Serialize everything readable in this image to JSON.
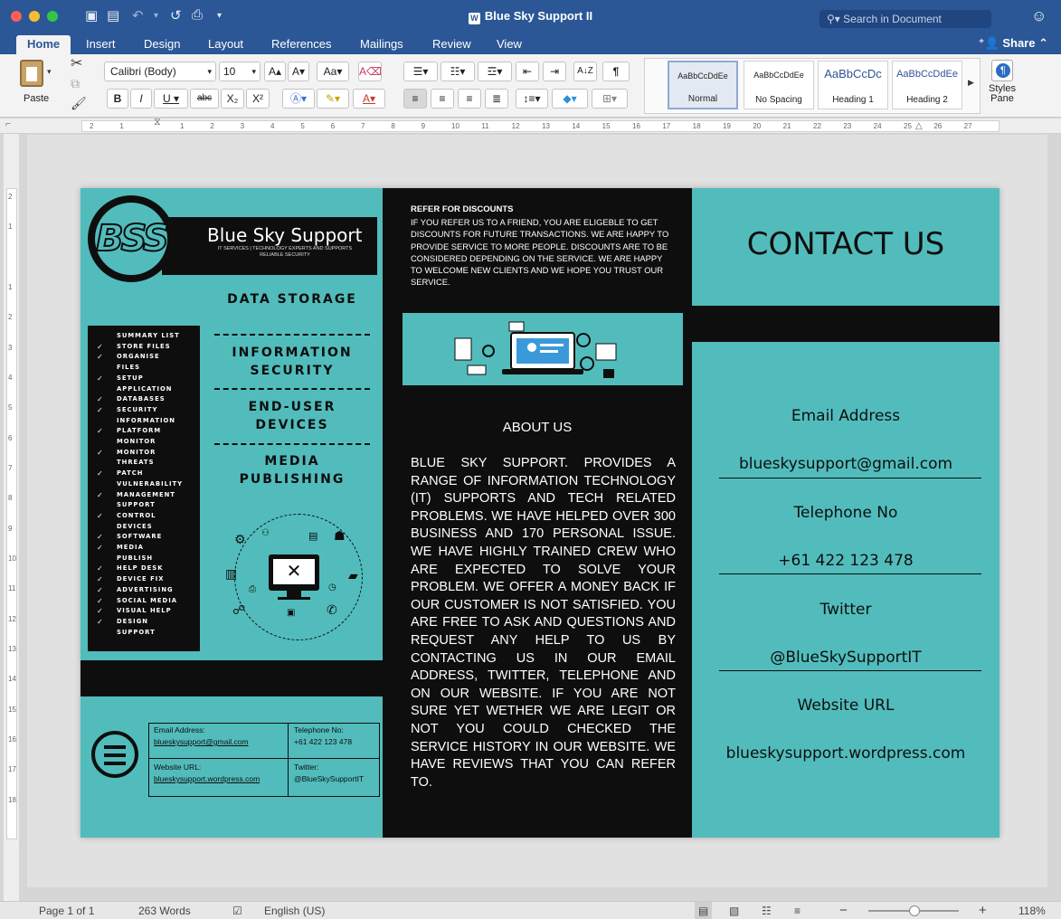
{
  "window": {
    "title": "Blue Sky Support II",
    "search_placeholder": "Search in Document"
  },
  "ribbon_tabs": [
    "Home",
    "Insert",
    "Design",
    "Layout",
    "References",
    "Mailings",
    "Review",
    "View"
  ],
  "share_label": "Share",
  "ribbon": {
    "paste_label": "Paste",
    "font_name": "Calibri (Body)",
    "font_size": "10",
    "styles": [
      {
        "sample": "AaBbCcDdEe",
        "name": "Normal"
      },
      {
        "sample": "AaBbCcDdEe",
        "name": "No Spacing"
      },
      {
        "sample": "AaBbCcDc",
        "name": "Heading 1"
      },
      {
        "sample": "AaBbCcDdEe",
        "name": "Heading 2"
      }
    ],
    "styles_pane_label": "Styles Pane"
  },
  "ruler_numbers": [
    "2",
    "1",
    "",
    "1",
    "2",
    "3",
    "4",
    "5",
    "6",
    "7",
    "8",
    "9",
    "10",
    "11",
    "12",
    "13",
    "14",
    "15",
    "16",
    "17",
    "18",
    "19",
    "20",
    "21",
    "22",
    "23",
    "24",
    "25",
    "26",
    "27"
  ],
  "vruler_numbers": [
    "2",
    "1",
    "",
    "1",
    "2",
    "3",
    "4",
    "5",
    "6",
    "7",
    "8",
    "9",
    "10",
    "11",
    "12",
    "13",
    "14",
    "15",
    "16",
    "17",
    "18"
  ],
  "doc": {
    "panel1": {
      "logo_text": "BSS",
      "brand_title": "Blue Sky Support",
      "brand_subtitle": "IT SERVICES | TECHNOLOGY EXPERTS AND SUPPORTS RELIABLE SECURITY",
      "services": [
        "DATA STORAGE",
        "INFORMATION SECURITY",
        "END-USER DEVICES",
        "MEDIA PUBLISHING"
      ],
      "checklist": [
        {
          "mark": "",
          "text": "Summary List"
        },
        {
          "mark": "✓",
          "text": "Store Files"
        },
        {
          "mark": "✓",
          "text": "Organise"
        },
        {
          "mark": "",
          "text": "Files"
        },
        {
          "mark": "✓",
          "text": "Setup"
        },
        {
          "mark": "",
          "text": "Application"
        },
        {
          "mark": "✓",
          "text": "Databases"
        },
        {
          "mark": "✓",
          "text": "Security"
        },
        {
          "mark": "",
          "text": "Information"
        },
        {
          "mark": "✓",
          "text": "Platform"
        },
        {
          "mark": "",
          "text": "Monitor"
        },
        {
          "mark": "✓",
          "text": "Monitor"
        },
        {
          "mark": "",
          "text": "Threats"
        },
        {
          "mark": "✓",
          "text": "Patch"
        },
        {
          "mark": "",
          "text": "Vulnerability"
        },
        {
          "mark": "✓",
          "text": "Management"
        },
        {
          "mark": "",
          "text": "Support"
        },
        {
          "mark": "✓",
          "text": "Control"
        },
        {
          "mark": "",
          "text": "Devices"
        },
        {
          "mark": "✓",
          "text": "Software"
        },
        {
          "mark": "✓",
          "text": "Media"
        },
        {
          "mark": "",
          "text": "Publish"
        },
        {
          "mark": "✓",
          "text": "Help Desk"
        },
        {
          "mark": "✓",
          "text": "Device Fix"
        },
        {
          "mark": "✓",
          "text": "Advertising"
        },
        {
          "mark": "✓",
          "text": "Social Media"
        },
        {
          "mark": "✓",
          "text": "Visual Help"
        },
        {
          "mark": "✓",
          "text": "Design"
        },
        {
          "mark": "",
          "text": "Support"
        }
      ],
      "contact_table": {
        "email_label": "Email Address:",
        "email_value": "blueskysupport@gmail.com",
        "phone_label": "Telephone No:",
        "phone_value": "+61 422 123 478",
        "website_label": "Website URL:",
        "website_value": "blueskysupport.wordpress.com",
        "twitter_label": "Twitter:",
        "twitter_value": "@BlueSkySupportIT"
      }
    },
    "panel2": {
      "refer_heading": "REFER FOR DISCOUNTS",
      "refer_body": "IF YOU REFER US TO A FRIEND, YOU ARE ELIGEBLE TO GET DISCOUNTS FOR FUTURE TRANSACTIONS. WE ARE HAPPY TO PROVIDE SERVICE TO MORE PEOPLE. DISCOUNTS ARE TO BE CONSIDERED DEPENDING ON THE SERVICE. WE ARE HAPPY TO WELCOME NEW CLIENTS AND WE HOPE YOU TRUST OUR SERVICE.",
      "about_heading": "ABOUT US",
      "about_body": "BLUE SKY SUPPORT. PROVIDES A RANGE OF INFORMATION TECHNOLOGY (IT) SUPPORTS AND TECH RELATED PROBLEMS. WE HAVE HELPED OVER 300 BUSINESS AND 170 PERSONAL ISSUE. WE HAVE HIGHLY TRAINED CREW WHO ARE EXPECTED TO SOLVE YOUR PROBLEM. WE OFFER A MONEY BACK IF OUR CUSTOMER IS NOT SATISFIED. YOU ARE FREE TO ASK AND QUESTIONS AND REQUEST ANY HELP TO US BY CONTACTING US IN OUR EMAIL ADDRESS, TWITTER, TELEPHONE AND ON OUR WEBSITE. IF YOU ARE NOT SURE YET WETHER WE ARE LEGIT OR NOT YOU COULD CHECKED THE SERVICE HISTORY IN OUR WEBSITE. WE HAVE REVIEWS THAT YOU CAN REFER TO."
    },
    "panel3": {
      "heading": "CONTACT US",
      "email_label": "Email Address",
      "email_value": "blueskysupport@gmail.com",
      "phone_label": "Telephone No",
      "phone_value": "+61 422 123 478",
      "twitter_label": "Twitter",
      "twitter_value": "@BlueSkySupportIT",
      "website_label": "Website URL",
      "website_value": "blueskysupport.wordpress.com"
    }
  },
  "status": {
    "page": "Page 1 of 1",
    "words": "263 Words",
    "language": "English (US)",
    "zoom": "118%"
  },
  "colors": {
    "word_blue": "#2b5797",
    "brochure_teal": "#52bcbc",
    "brochure_black": "#0e0e0e"
  }
}
